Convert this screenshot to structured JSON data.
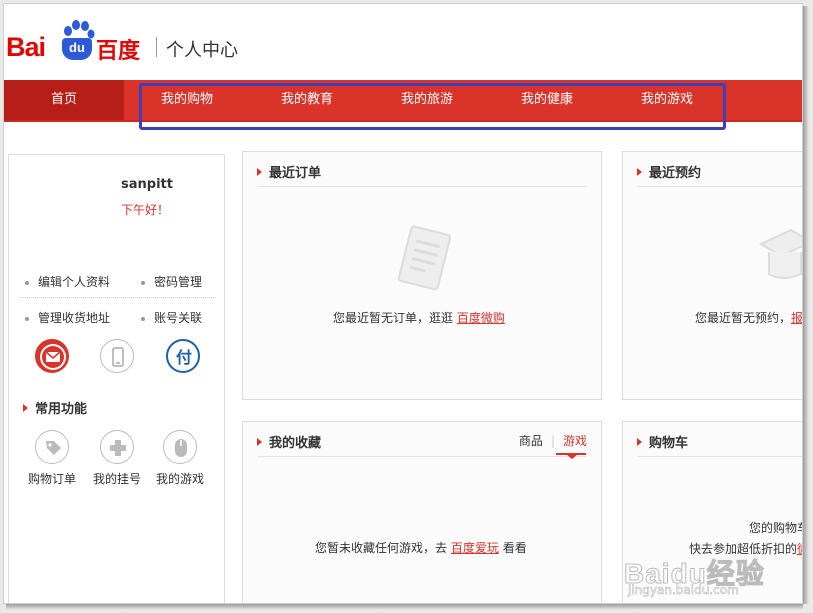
{
  "header": {
    "logo_bai": "Bai",
    "logo_du": "du",
    "logo_cn": "百度",
    "title": "个人中心"
  },
  "nav": {
    "home": "首页",
    "items": [
      "我的购物",
      "我的教育",
      "我的旅游",
      "我的健康",
      "我的游戏"
    ]
  },
  "profile": {
    "username": "sanpitt",
    "greeting": "下午好！",
    "links": [
      "编辑个人资料",
      "密码管理",
      "管理收货地址",
      "账号关联"
    ],
    "bind_icons": [
      "mail-icon",
      "phone-icon",
      "alipay-icon"
    ]
  },
  "common_functions": {
    "title": "常用功能",
    "items": [
      {
        "label": "购物订单",
        "icon": "tag-icon"
      },
      {
        "label": "我的挂号",
        "icon": "plus-icon"
      },
      {
        "label": "我的游戏",
        "icon": "mouse-icon"
      }
    ]
  },
  "orders": {
    "title": "最近订单",
    "empty_text": "您最近暂无订单，逛逛",
    "link": "百度微购"
  },
  "reservations": {
    "title": "最近预约",
    "empty_text": "您最近暂无预约，",
    "link": "报个"
  },
  "favorites": {
    "title": "我的收藏",
    "tabs": [
      "商品",
      "游戏"
    ],
    "active_tab": "游戏",
    "empty_text": "您暂未收藏任何游戏，去",
    "link": "百度爱玩",
    "suffix": "看看"
  },
  "cart": {
    "title": "购物车",
    "line1": "您的购物车",
    "line2": "快去参加超低折扣的",
    "link": "微"
  },
  "watermark": {
    "logo": "Baidu经验",
    "url": "jingyan.baidu.com"
  },
  "colors": {
    "nav_red": "#d9332a",
    "home_red": "#b71e18",
    "logo_red": "#e10601",
    "logo_blue": "#2d5ad6",
    "highlight_blue": "#3e3fb8"
  }
}
